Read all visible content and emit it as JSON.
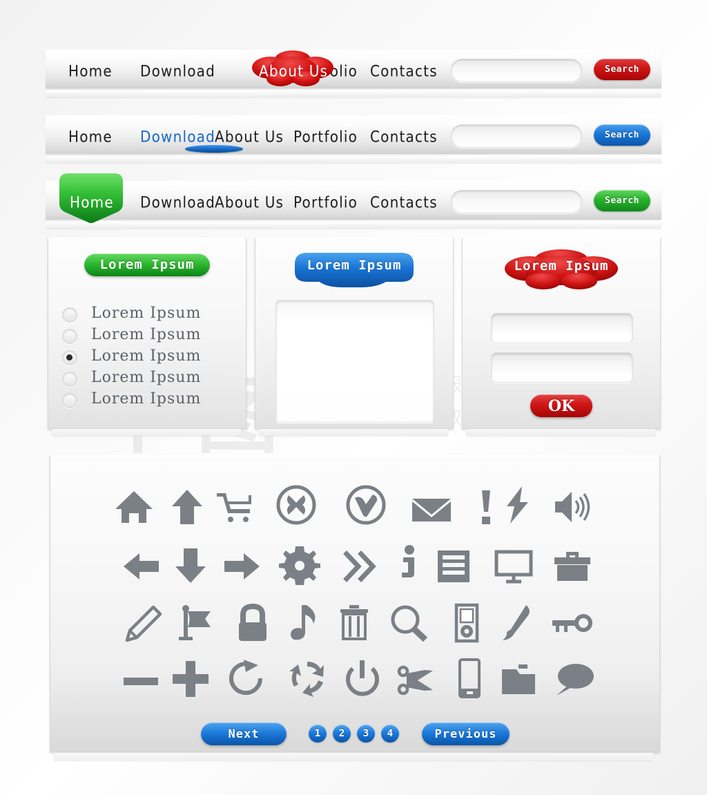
{
  "navbars": [
    {
      "id": "navbar-red",
      "accent": "#cf1414",
      "active": "About Us",
      "active_style": "cloud",
      "links": [
        "Home",
        "Download",
        "About Us",
        "Portfolio",
        "Contacts"
      ],
      "search_placeholder": "",
      "search_value": "",
      "search_label": "Search"
    },
    {
      "id": "navbar-blue",
      "accent": "#1668c4",
      "active": "Download",
      "active_style": "underline",
      "links": [
        "Home",
        "Download",
        "About Us",
        "Portfolio",
        "Contacts"
      ],
      "search_placeholder": "",
      "search_value": "",
      "search_label": "Search"
    },
    {
      "id": "navbar-green",
      "accent": "#28b22c",
      "active": "Home",
      "active_style": "shield",
      "links": [
        "Home",
        "Download",
        "About Us",
        "Portfolio",
        "Contacts"
      ],
      "search_placeholder": "",
      "search_value": "",
      "search_label": "Search"
    }
  ],
  "panel_radio": {
    "header_label": "Lorem Ipsum",
    "header_color": "#28b22c",
    "options": [
      {
        "label": "Lorem Ipsum",
        "selected": false
      },
      {
        "label": "Lorem Ipsum",
        "selected": false
      },
      {
        "label": "Lorem Ipsum",
        "selected": true
      },
      {
        "label": "Lorem Ipsum",
        "selected": false
      },
      {
        "label": "Lorem Ipsum",
        "selected": false
      }
    ]
  },
  "panel_textarea": {
    "header_label": "Lorem Ipsum",
    "header_color": "#1668c4",
    "textarea_value": "",
    "textarea_placeholder": ""
  },
  "panel_form": {
    "header_label": "Lorem Ipsum",
    "header_color": "#cf1616",
    "fields": [
      {
        "value": "",
        "placeholder": ""
      },
      {
        "value": "",
        "placeholder": ""
      }
    ],
    "submit_label": "OK"
  },
  "icon_panel": {
    "rows": [
      [
        {
          "name": "home-icon"
        },
        {
          "name": "arrow-up-icon"
        },
        {
          "name": "shopping-cart-icon"
        },
        {
          "name": "circle-close-icon"
        },
        {
          "name": "circle-check-icon"
        },
        {
          "name": "envelope-icon"
        },
        {
          "name": "exclamation-icon"
        },
        {
          "name": "lightning-bolt-icon"
        },
        {
          "name": "speaker-volume-icon"
        }
      ],
      [
        {
          "name": "arrow-left-icon"
        },
        {
          "name": "arrow-down-icon"
        },
        {
          "name": "arrow-right-icon"
        },
        {
          "name": "gear-icon"
        },
        {
          "name": "double-chevron-right-icon"
        },
        {
          "name": "info-icon"
        },
        {
          "name": "list-document-icon"
        },
        {
          "name": "monitor-icon"
        },
        {
          "name": "briefcase-icon"
        }
      ],
      [
        {
          "name": "pencil-edit-icon"
        },
        {
          "name": "flag-icon"
        },
        {
          "name": "lock-icon"
        },
        {
          "name": "music-note-icon"
        },
        {
          "name": "trash-icon"
        },
        {
          "name": "magnifier-search-icon"
        },
        {
          "name": "mp3-player-icon"
        },
        {
          "name": "quill-brush-icon"
        },
        {
          "name": "key-icon"
        }
      ],
      [
        {
          "name": "minus-icon"
        },
        {
          "name": "plus-icon"
        },
        {
          "name": "refresh-icon"
        },
        {
          "name": "recycle-icon"
        },
        {
          "name": "power-icon"
        },
        {
          "name": "scissors-icon"
        },
        {
          "name": "smartphone-icon"
        },
        {
          "name": "folder-icon"
        },
        {
          "name": "speech-bubble-icon"
        }
      ]
    ],
    "icon_color": "#7b8086",
    "pagination": {
      "next_label": "Next",
      "previous_label": "Previous",
      "pages": [
        "1",
        "2",
        "3",
        "4"
      ]
    }
  },
  "watermark": {
    "line1": "营销创意服务与协作平台",
    "line2": "商用请获取授权",
    "logo_text": "千图"
  }
}
